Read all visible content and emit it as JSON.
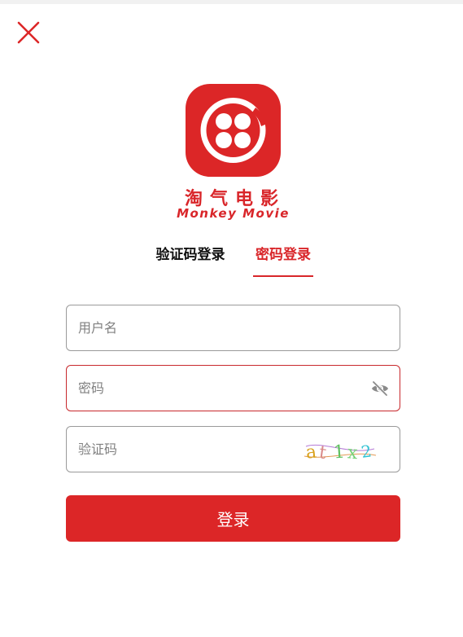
{
  "colors": {
    "brand_red": "#dc2627",
    "text_dark": "#111111",
    "placeholder": "#808080",
    "border": "#9a9a9a"
  },
  "icons": {
    "close": "close-icon",
    "logo": "film-reel-logo-icon",
    "password_visibility": "eye-slash-icon"
  },
  "brand": {
    "name_cn": "淘气电影",
    "name_en": "Monkey Movie"
  },
  "tabs": [
    {
      "label": "验证码登录",
      "active": false
    },
    {
      "label": "密码登录",
      "active": true
    }
  ],
  "form": {
    "username_placeholder": "用户名",
    "password_placeholder": "密码",
    "captcha_placeholder": "验证码",
    "captcha_image_text": "at1x2",
    "submit_label": "登录"
  }
}
